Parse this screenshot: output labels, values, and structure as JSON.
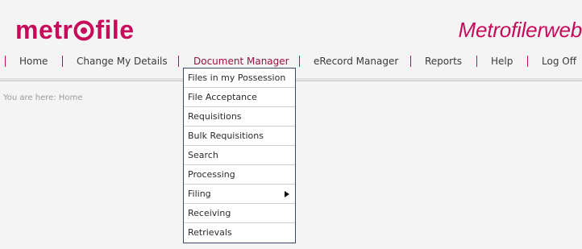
{
  "brand": {
    "logo_left": "metr",
    "logo_right": "file",
    "title": "Metrofilerweb"
  },
  "colors": {
    "accent": "#c80a5a",
    "menu_border": "#3a4a66"
  },
  "nav": {
    "items": [
      {
        "label": "Home"
      },
      {
        "label": "Change My Details"
      },
      {
        "label": "Document Manager"
      },
      {
        "label": "eRecord Manager"
      },
      {
        "label": "Reports"
      },
      {
        "label": "Help"
      },
      {
        "label": "Log Off"
      }
    ],
    "active_index": 2
  },
  "breadcrumb": {
    "prefix": "You are here:",
    "current": "Home"
  },
  "dropdown": {
    "items": [
      {
        "label": "Files in my Possession"
      },
      {
        "label": "File Acceptance"
      },
      {
        "label": "Requisitions"
      },
      {
        "label": "Bulk Requisitions"
      },
      {
        "label": "Search"
      },
      {
        "label": "Processing"
      },
      {
        "label": "Filing",
        "icon": "submenu-arrow-icon"
      },
      {
        "label": "Receiving"
      },
      {
        "label": "Retrievals"
      }
    ]
  }
}
